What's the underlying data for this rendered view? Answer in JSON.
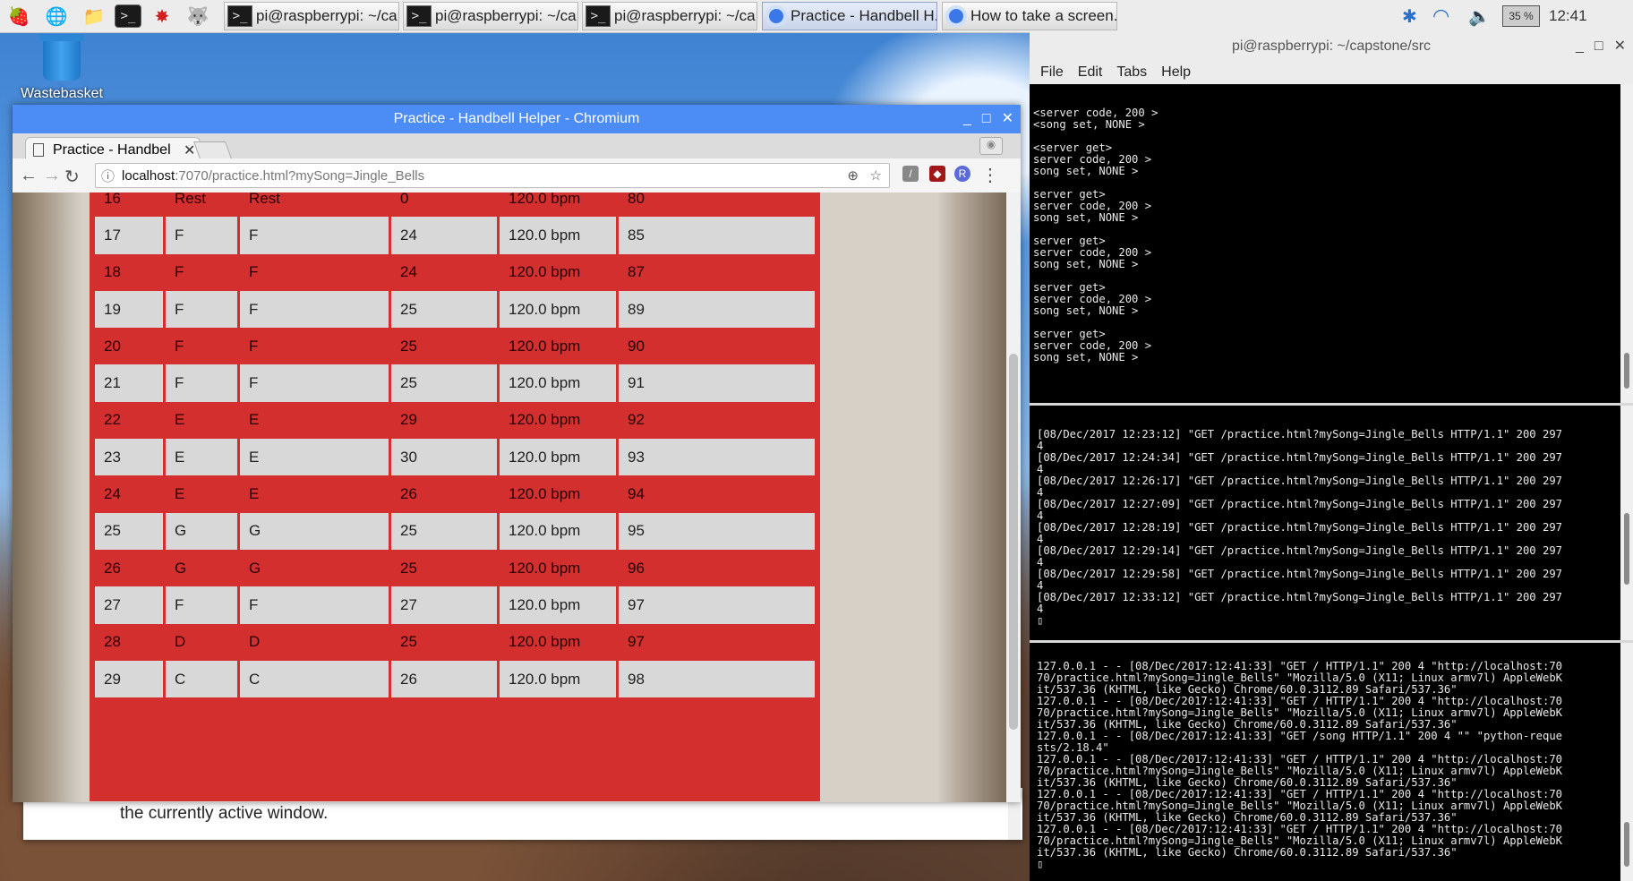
{
  "taskbar": {
    "tasks": [
      {
        "label": "pi@raspberrypi: ~/ca...",
        "kind": "terminal"
      },
      {
        "label": "pi@raspberrypi: ~/ca...",
        "kind": "terminal"
      },
      {
        "label": "pi@raspberrypi: ~/ca...",
        "kind": "terminal"
      },
      {
        "label": "Practice - Handbell H...",
        "kind": "chromium"
      },
      {
        "label": "How to take a screen...",
        "kind": "chromium"
      }
    ],
    "battery": "35 %",
    "clock": "12:41"
  },
  "desktop": {
    "wastebasket_label": "Wastebasket"
  },
  "background_doc": {
    "text": "the currently active window."
  },
  "chromium": {
    "window_title": "Practice - Handbell Helper - Chromium",
    "tab_title": "Practice - Handbel",
    "url_host": "localhost",
    "url_rest": ":7070/practice.html?mySong=Jingle_Bells",
    "rows": [
      [
        "16",
        "Rest",
        "Rest",
        "0",
        "120.0 bpm",
        "80"
      ],
      [
        "17",
        "F",
        "F",
        "24",
        "120.0 bpm",
        "85"
      ],
      [
        "18",
        "F",
        "F",
        "24",
        "120.0 bpm",
        "87"
      ],
      [
        "19",
        "F",
        "F",
        "25",
        "120.0 bpm",
        "89"
      ],
      [
        "20",
        "F",
        "F",
        "25",
        "120.0 bpm",
        "90"
      ],
      [
        "21",
        "F",
        "F",
        "25",
        "120.0 bpm",
        "91"
      ],
      [
        "22",
        "E",
        "E",
        "29",
        "120.0 bpm",
        "92"
      ],
      [
        "23",
        "E",
        "E",
        "30",
        "120.0 bpm",
        "93"
      ],
      [
        "24",
        "E",
        "E",
        "26",
        "120.0 bpm",
        "94"
      ],
      [
        "25",
        "G",
        "G",
        "25",
        "120.0 bpm",
        "95"
      ],
      [
        "26",
        "G",
        "G",
        "25",
        "120.0 bpm",
        "96"
      ],
      [
        "27",
        "F",
        "F",
        "27",
        "120.0 bpm",
        "97"
      ],
      [
        "28",
        "D",
        "D",
        "25",
        "120.0 bpm",
        "97"
      ],
      [
        "29",
        "C",
        "C",
        "26",
        "120.0 bpm",
        "98"
      ]
    ]
  },
  "terminal": {
    "window_title": "pi@raspberrypi: ~/capstone/src",
    "menu": [
      "File",
      "Edit",
      "Tabs",
      "Help"
    ],
    "pane1": "<server code, 200 >\n<song set, NONE >\n\n<server get>\nserver code, 200 >\nsong set, NONE >\n\nserver get>\nserver code, 200 >\nsong set, NONE >\n\nserver get>\nserver code, 200 >\nsong set, NONE >\n\nserver get>\nserver code, 200 >\nsong set, NONE >\n\nserver get>\nserver code, 200 >\nsong set, NONE >",
    "pane2": "[08/Dec/2017 12:23:12] \"GET /practice.html?mySong=Jingle_Bells HTTP/1.1\" 200 297\n4\n[08/Dec/2017 12:24:34] \"GET /practice.html?mySong=Jingle_Bells HTTP/1.1\" 200 297\n4\n[08/Dec/2017 12:26:17] \"GET /practice.html?mySong=Jingle_Bells HTTP/1.1\" 200 297\n4\n[08/Dec/2017 12:27:09] \"GET /practice.html?mySong=Jingle_Bells HTTP/1.1\" 200 297\n4\n[08/Dec/2017 12:28:19] \"GET /practice.html?mySong=Jingle_Bells HTTP/1.1\" 200 297\n4\n[08/Dec/2017 12:29:14] \"GET /practice.html?mySong=Jingle_Bells HTTP/1.1\" 200 297\n4\n[08/Dec/2017 12:29:58] \"GET /practice.html?mySong=Jingle_Bells HTTP/1.1\" 200 297\n4\n[08/Dec/2017 12:33:12] \"GET /practice.html?mySong=Jingle_Bells HTTP/1.1\" 200 297\n4\n▯",
    "pane3": "127.0.0.1 - - [08/Dec/2017:12:41:33] \"GET / HTTP/1.1\" 200 4 \"http://localhost:70\n70/practice.html?mySong=Jingle_Bells\" \"Mozilla/5.0 (X11; Linux armv7l) AppleWebK\nit/537.36 (KHTML, like Gecko) Chrome/60.0.3112.89 Safari/537.36\"\n127.0.0.1 - - [08/Dec/2017:12:41:33] \"GET / HTTP/1.1\" 200 4 \"http://localhost:70\n70/practice.html?mySong=Jingle_Bells\" \"Mozilla/5.0 (X11; Linux armv7l) AppleWebK\nit/537.36 (KHTML, like Gecko) Chrome/60.0.3112.89 Safari/537.36\"\n127.0.0.1 - - [08/Dec/2017:12:41:33] \"GET /song HTTP/1.1\" 200 4 \"\" \"python-reque\nsts/2.18.4\"\n127.0.0.1 - - [08/Dec/2017:12:41:33] \"GET / HTTP/1.1\" 200 4 \"http://localhost:70\n70/practice.html?mySong=Jingle_Bells\" \"Mozilla/5.0 (X11; Linux armv7l) AppleWebK\nit/537.36 (KHTML, like Gecko) Chrome/60.0.3112.89 Safari/537.36\"\n127.0.0.1 - - [08/Dec/2017:12:41:33] \"GET / HTTP/1.1\" 200 4 \"http://localhost:70\n70/practice.html?mySong=Jingle_Bells\" \"Mozilla/5.0 (X11; Linux armv7l) AppleWebK\nit/537.36 (KHTML, like Gecko) Chrome/60.0.3112.89 Safari/537.36\"\n127.0.0.1 - - [08/Dec/2017:12:41:33] \"GET / HTTP/1.1\" 200 4 \"http://localhost:70\n70/practice.html?mySong=Jingle_Bells\" \"Mozilla/5.0 (X11; Linux armv7l) AppleWebK\nit/537.36 (KHTML, like Gecko) Chrome/60.0.3112.89 Safari/537.36\"\n▯"
  }
}
